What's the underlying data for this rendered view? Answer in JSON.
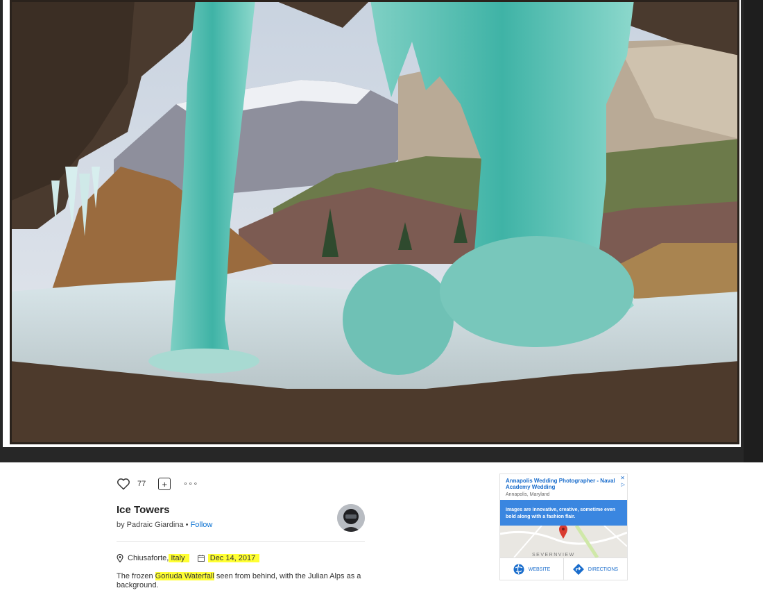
{
  "photo": {
    "description_icon": "photo-ice-towers"
  },
  "actions": {
    "like_icon": "heart-icon",
    "like_count": "77",
    "add_icon": "add-to-gallery-icon",
    "add_glyph": "+",
    "more_icon": "more-icon",
    "more_glyph": "∘∘∘"
  },
  "photo_info": {
    "title": "Ice Towers",
    "by_prefix": "by Padraic Giardina",
    "separator": " • ",
    "follow_label": "Follow",
    "location_prefix": "Chiusaforte,",
    "location_highlight": "Italy",
    "date": "Dec 14, 2017",
    "description_before": "The frozen ",
    "description_highlight": "Goriuda Waterfall",
    "description_after": " seen from behind, with the Julian Alps as a background."
  },
  "ad": {
    "title": "Annapolis Wedding Photographer - Naval Academy Wedding",
    "subtitle": "Annapolis, Maryland",
    "close_glyph": "✕",
    "play_glyph": "▷",
    "body": "Images are innovative, creative, sometime even bold along with a fashion flair.",
    "map_label": "SEVERNVIEW",
    "website_label": "WEBSITE",
    "directions_label": "DIRECTIONS"
  },
  "colors": {
    "stage_bg": "#272727",
    "highlight": "#ffff33",
    "link": "#0870d1",
    "ad_blue": "#3a86e0"
  }
}
